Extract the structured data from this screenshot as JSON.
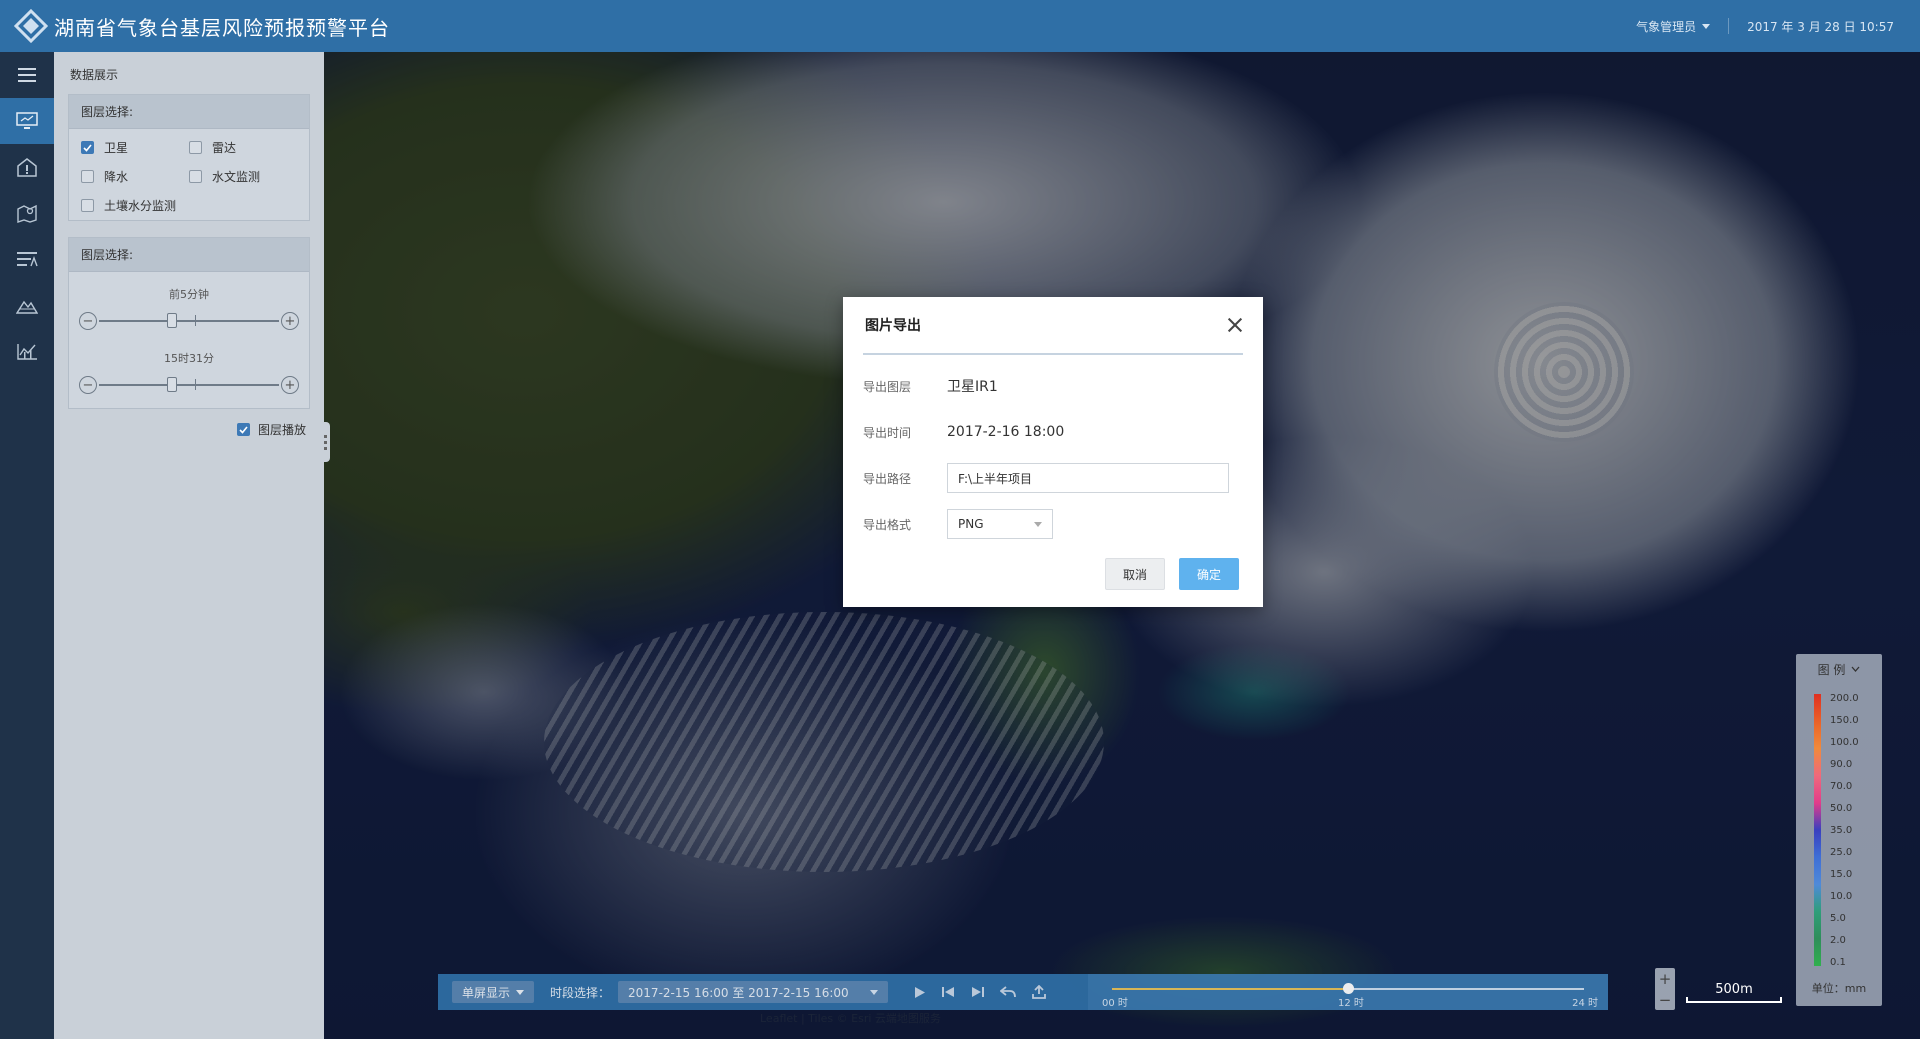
{
  "header": {
    "title": "湖南省气象台基层风险预报预警平台",
    "user": "气象管理员",
    "datetime": "2017 年 3 月 28 日 10:57"
  },
  "iconbar": {
    "items": [
      "menu-icon",
      "monitor-icon",
      "alert-house-icon",
      "map-pin-icon",
      "layers-icon",
      "terrain-icon",
      "chart-icon"
    ]
  },
  "panel": {
    "title": "数据展示",
    "layer_group_1": {
      "header": "图层选择:",
      "layers": [
        {
          "label": "卫星",
          "checked": true
        },
        {
          "label": "雷达",
          "checked": false
        },
        {
          "label": "降水",
          "checked": false
        },
        {
          "label": "水文监测",
          "checked": false
        },
        {
          "label": "土壤水分监测",
          "checked": false
        }
      ]
    },
    "layer_group_2": {
      "header": "图层选择:",
      "slider1_label": "前5分钟",
      "slider2_label": "15时31分"
    },
    "playback_label": "图层播放",
    "playback_checked": true
  },
  "legend": {
    "title": "图 例",
    "values": [
      "200.0",
      "150.0",
      "100.0",
      "90.0",
      "70.0",
      "50.0",
      "35.0",
      "25.0",
      "15.0",
      "10.0",
      "5.0",
      "2.0",
      "0.1"
    ],
    "unit": "单位：mm"
  },
  "map": {
    "scale": "500m",
    "credit": "Leaflet | Tiles © Esri 云端地图服务"
  },
  "timebar": {
    "mode": "单屏显示",
    "period_label": "时段选择：",
    "range": "2017-2-15 16:00 至 2017-2-15 16:00",
    "labels": [
      "00 时",
      "12 时",
      "24 时"
    ],
    "progress": 0.5
  },
  "modal": {
    "title": "图片导出",
    "layer_label": "导出图层",
    "layer_value": "卫星IR1",
    "time_label": "导出时间",
    "time_value": "2017-2-16 18:00",
    "path_label": "导出路径",
    "path_value": "F:\\上半年项目",
    "format_label": "导出格式",
    "format_value": "PNG",
    "cancel": "取消",
    "ok": "确定"
  }
}
